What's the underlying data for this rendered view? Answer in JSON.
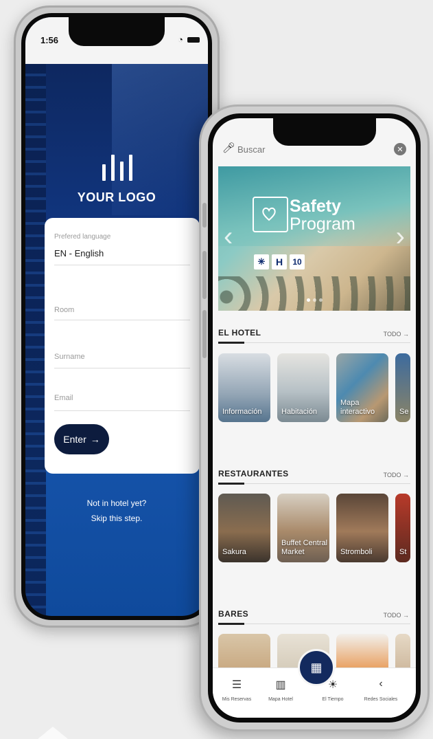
{
  "login_screen": {
    "status_time": "1:56",
    "logo_text": "YOUR LOGO",
    "language_label": "Prefered language",
    "language_value": "EN - English",
    "room_placeholder": "Room",
    "surname_placeholder": "Surname",
    "email_placeholder": "Email",
    "enter_label": "Enter",
    "skip_line1": "Not in hotel yet?",
    "skip_line2": "Skip this step."
  },
  "hotel_app": {
    "search_placeholder": "Buscar",
    "banner": {
      "title_line1": "Safety",
      "title_line2": "Program",
      "badge_h": "H",
      "badge_10": "10"
    },
    "sections": [
      {
        "title": "EL HOTEL",
        "todo_label": "TODO",
        "cards": [
          "Información",
          "Habitación",
          "Mapa interactivo",
          "Se"
        ]
      },
      {
        "title": "RESTAURANTES",
        "todo_label": "TODO",
        "cards": [
          "Sakura",
          "Buffet Central Market",
          "Stromboli",
          "St"
        ]
      },
      {
        "title": "BARES",
        "todo_label": "TODO",
        "cards": [
          "",
          "",
          "",
          ""
        ]
      }
    ],
    "tabs": [
      {
        "label": "Mis Reservas",
        "icon": "list-icon"
      },
      {
        "label": "Mapa Hotel",
        "icon": "map-icon"
      },
      {
        "label": "El Tiempo",
        "icon": "sun-icon"
      },
      {
        "label": "Redes Sociales",
        "icon": "share-icon"
      }
    ]
  },
  "colors": {
    "brand_navy": "#0d1c3e",
    "login_bg": "#123a8a",
    "qr_button": "#132a5e"
  }
}
